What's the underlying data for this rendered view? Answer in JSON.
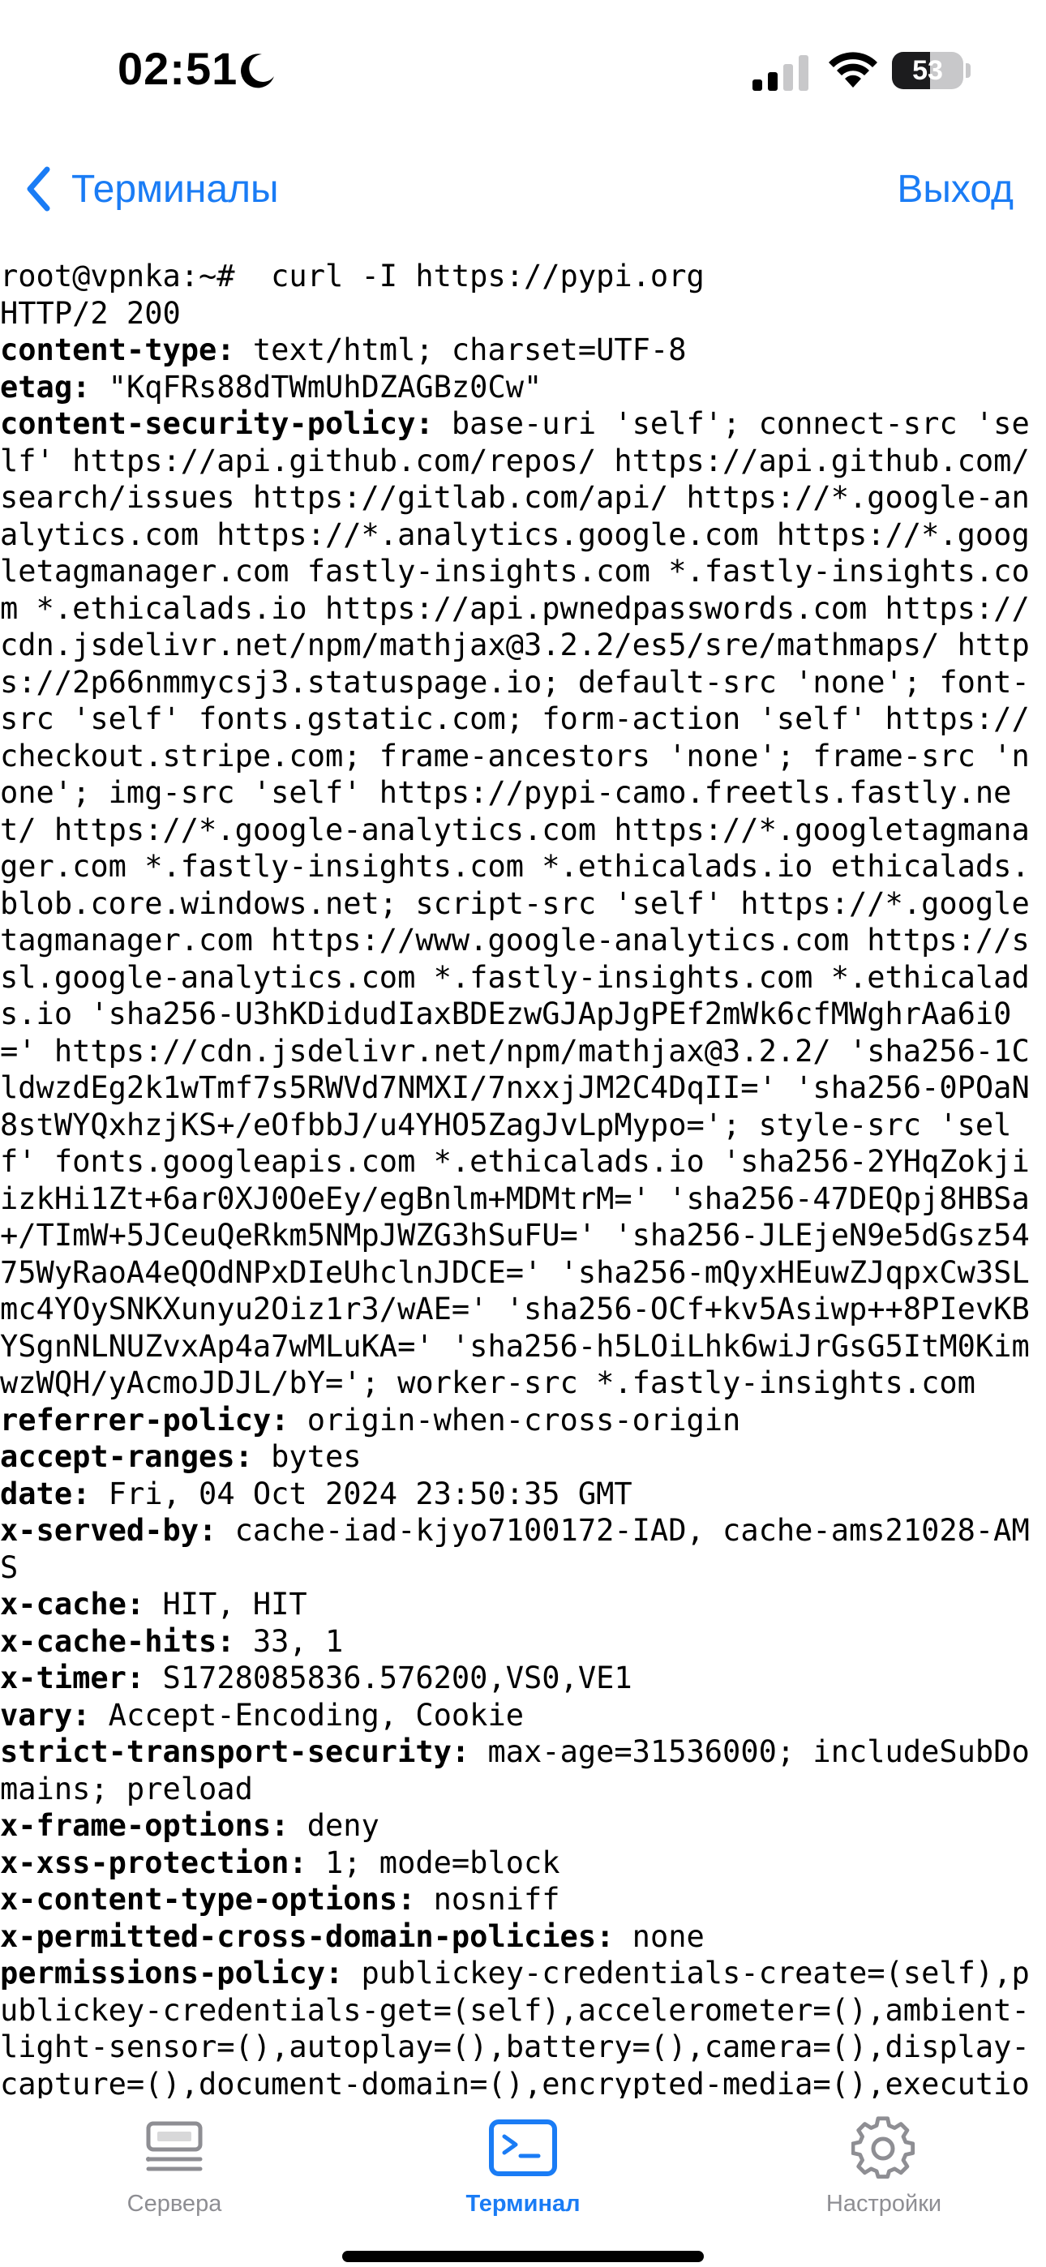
{
  "status_bar": {
    "time": "02:51",
    "battery_level": "53",
    "battery_fraction": 0.53,
    "focus_icon": "moon-icon"
  },
  "nav": {
    "back_label": "Терминалы",
    "logout_label": "Выход",
    "accent_color": "#1a7cf5"
  },
  "terminal": {
    "command_line": "root@vpnka:~#  curl -I https://pypi.org",
    "status_line": "HTTP/2 200",
    "headers": [
      {
        "key": "content-type:",
        "value": " text/html; charset=UTF-8"
      },
      {
        "key": "etag:",
        "value": " \"KqFRs88dTWmUhDZAGBz0Cw\""
      },
      {
        "key": "content-security-policy:",
        "value": " base-uri 'self'; connect-src 'self' https://api.github.com/repos/ https://api.github.com/search/issues https://gitlab.com/api/ https://*.google-analytics.com https://*.analytics.google.com https://*.googletagmanager.com fastly-insights.com *.fastly-insights.com *.ethicalads.io https://api.pwnedpasswords.com https://cdn.jsdelivr.net/npm/mathjax@3.2.2/es5/sre/mathmaps/ https://2p66nmmycsj3.statuspage.io; default-src 'none'; font-src 'self' fonts.gstatic.com; form-action 'self' https://checkout.stripe.com; frame-ancestors 'none'; frame-src 'none'; img-src 'self' https://pypi-camo.freetls.fastly.net/ https://*.google-analytics.com https://*.googletagmanager.com *.fastly-insights.com *.ethicalads.io ethicalads.blob.core.windows.net; script-src 'self' https://*.googletagmanager.com https://www.google-analytics.com https://ssl.google-analytics.com *.fastly-insights.com *.ethicalads.io 'sha256-U3hKDidudIaxBDEzwGJApJgPEf2mWk6cfMWghrAa6i0=' https://cdn.jsdelivr.net/npm/mathjax@3.2.2/ 'sha256-1CldwzdEg2k1wTmf7s5RWVd7NMXI/7nxxjJM2C4DqII=' 'sha256-0POaN8stWYQxhzjKS+/eOfbbJ/u4YHO5ZagJvLpMypo='; style-src 'self' fonts.googleapis.com *.ethicalads.io 'sha256-2YHqZokjiizkHi1Zt+6ar0XJ0OeEy/egBnlm+MDMtrM=' 'sha256-47DEQpj8HBSa+/TImW+5JCeuQeRkm5NMpJWZG3hSuFU=' 'sha256-JLEjeN9e5dGsz5475WyRaoA4eQOdNPxDIeUhclnJDCE=' 'sha256-mQyxHEuwZJqpxCw3SLmc4YOySNKXunyu2Oiz1r3/wAE=' 'sha256-OCf+kv5Asiwp++8PIevKBYSgnNLNUZvxAp4a7wMLuKA=' 'sha256-h5LOiLhk6wiJrGsG5ItM0KimwzWQH/yAcmoJDJL/bY='; worker-src *.fastly-insights.com"
      },
      {
        "key": "referrer-policy:",
        "value": " origin-when-cross-origin"
      },
      {
        "key": "accept-ranges:",
        "value": " bytes"
      },
      {
        "key": "date:",
        "value": " Fri, 04 Oct 2024 23:50:35 GMT"
      },
      {
        "key": "x-served-by:",
        "value": " cache-iad-kjyo7100172-IAD, cache-ams21028-AMS"
      },
      {
        "key": "x-cache:",
        "value": " HIT, HIT"
      },
      {
        "key": "x-cache-hits:",
        "value": " 33, 1"
      },
      {
        "key": "x-timer:",
        "value": " S1728085836.576200,VS0,VE1"
      },
      {
        "key": "vary:",
        "value": " Accept-Encoding, Cookie"
      },
      {
        "key": "strict-transport-security:",
        "value": " max-age=31536000; includeSubDomains; preload"
      },
      {
        "key": "x-frame-options:",
        "value": " deny"
      },
      {
        "key": "x-xss-protection:",
        "value": " 1; mode=block"
      },
      {
        "key": "x-content-type-options:",
        "value": " nosniff"
      },
      {
        "key": "x-permitted-cross-domain-policies:",
        "value": " none"
      },
      {
        "key": "permissions-policy:",
        "value": " publickey-credentials-create=(self),publickey-credentials-get=(self),accelerometer=(),ambient-light-sensor=(),autoplay=(),battery=(),camera=(),display-capture=(),document-domain=(),encrypted-media=(),executio"
      }
    ]
  },
  "tabs": [
    {
      "label": "Сервера",
      "icon": "servers-icon",
      "active": false
    },
    {
      "label": "Терминал",
      "icon": "terminal-icon",
      "active": true
    },
    {
      "label": "Настройки",
      "icon": "gear-icon",
      "active": false
    }
  ],
  "colors": {
    "active_tab": "#1a7cf5",
    "inactive_tab": "#8e8e93"
  }
}
